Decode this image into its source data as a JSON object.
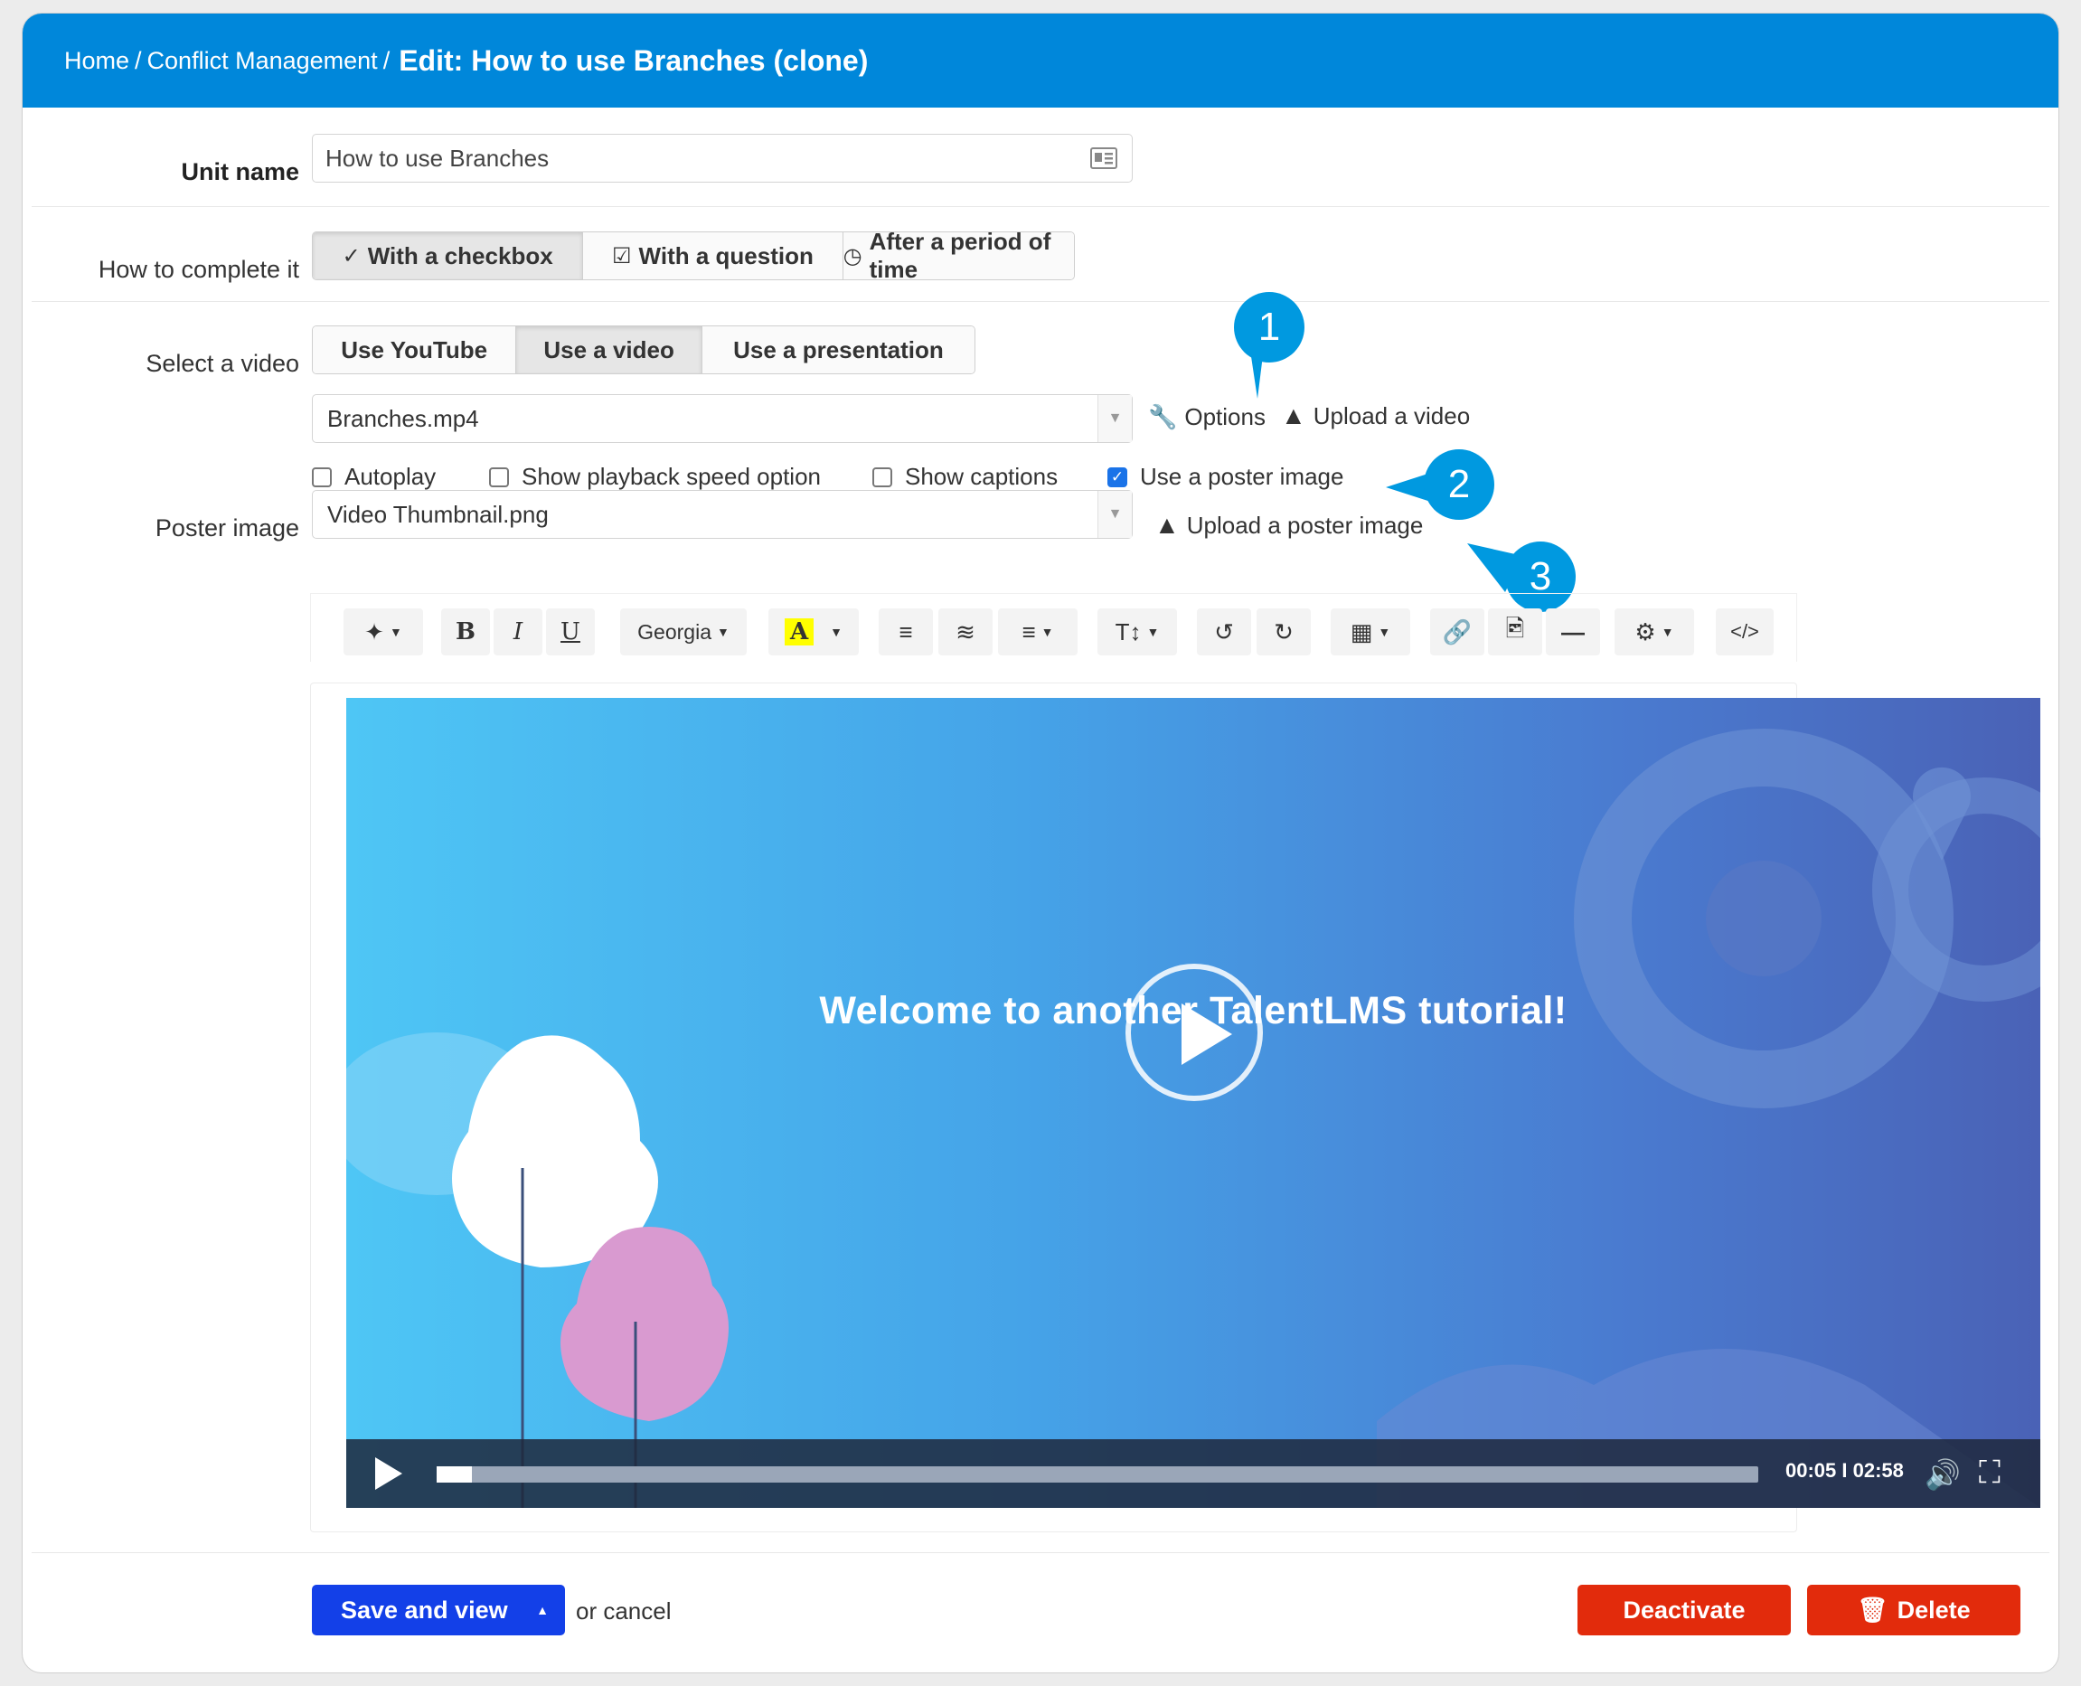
{
  "breadcrumb": {
    "home": "Home",
    "separator": "/",
    "course": "Conflict Management",
    "title": "Edit: How to use Branches (clone)"
  },
  "unit_name": {
    "label": "Unit name",
    "value": "How to use Branches"
  },
  "completion": {
    "label": "How to complete it",
    "options": [
      "With a checkbox",
      "With a question",
      "After a period of time"
    ],
    "active": "With a checkbox"
  },
  "video_source": {
    "label": "Select a video",
    "options": [
      "Use YouTube",
      "Use a video",
      "Use a presentation"
    ],
    "active": "Use a video",
    "selected_file": "Branches.mp4",
    "options_link": "Options",
    "upload_link": "Upload a video"
  },
  "checkboxes": [
    {
      "label": "Autoplay",
      "checked": false
    },
    {
      "label": "Show playback speed option",
      "checked": false
    },
    {
      "label": "Show captions",
      "checked": false
    },
    {
      "label": "Use a poster image",
      "checked": true
    }
  ],
  "poster": {
    "label": "Poster image",
    "selected_file": "Video Thumbnail.png",
    "upload_link": "Upload a poster image"
  },
  "callouts": [
    "1",
    "2",
    "3"
  ],
  "toolbar": {
    "font": "Georgia",
    "bold": "B",
    "italic": "I",
    "underline": "U",
    "highlight": "A",
    "text_size": "T↕"
  },
  "video": {
    "title": "Welcome to another TalentLMS tutorial!",
    "time": "00:05 I 02:58",
    "progress": 0.027
  },
  "footer": {
    "save_label": "Save and view",
    "or_cancel": "or cancel",
    "deactivate_label": "Deactivate",
    "delete_label": "Delete"
  },
  "colors": {
    "header": "#0087da",
    "callout": "#0099e0",
    "save": "#1340e8",
    "danger": "#e22b0c"
  }
}
